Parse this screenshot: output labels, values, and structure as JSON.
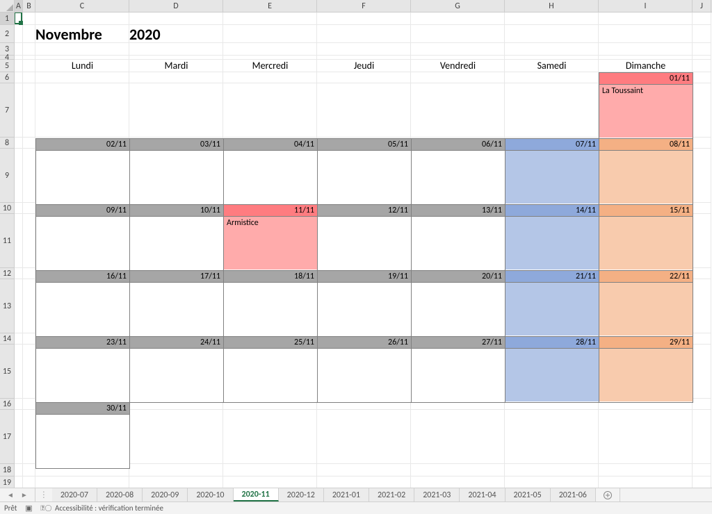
{
  "columns": [
    {
      "label": "A",
      "w": 12,
      "sel": true
    },
    {
      "label": "B",
      "w": 18
    },
    {
      "label": "C",
      "w": 135
    },
    {
      "label": "D",
      "w": 135
    },
    {
      "label": "E",
      "w": 135
    },
    {
      "label": "F",
      "w": 135
    },
    {
      "label": "G",
      "w": 135
    },
    {
      "label": "H",
      "w": 135
    },
    {
      "label": "I",
      "w": 135
    },
    {
      "label": "J",
      "w": 27
    }
  ],
  "rows": [
    {
      "n": 1,
      "h": 18,
      "sel": true
    },
    {
      "n": 2,
      "h": 26
    },
    {
      "n": 3,
      "h": 18
    },
    {
      "n": 4,
      "h": 6
    },
    {
      "n": 5,
      "h": 18
    },
    {
      "n": 6,
      "h": 16
    },
    {
      "n": 7,
      "h": 78
    },
    {
      "n": 8,
      "h": 16
    },
    {
      "n": 9,
      "h": 78
    },
    {
      "n": 10,
      "h": 16
    },
    {
      "n": 11,
      "h": 78
    },
    {
      "n": 12,
      "h": 16
    },
    {
      "n": 13,
      "h": 78
    },
    {
      "n": 14,
      "h": 16
    },
    {
      "n": 15,
      "h": 78
    },
    {
      "n": 16,
      "h": 16
    },
    {
      "n": 17,
      "h": 78
    },
    {
      "n": 18,
      "h": 18
    },
    {
      "n": 19,
      "h": 18
    }
  ],
  "title": {
    "month": "Novembre",
    "year": "2020"
  },
  "day_names": [
    "Lundi",
    "Mardi",
    "Mercredi",
    "Jeudi",
    "Vendredi",
    "Samedi",
    "Dimanche"
  ],
  "weeks": [
    [
      null,
      null,
      null,
      null,
      null,
      null,
      {
        "d": "01/11",
        "txt": "La Toussaint",
        "hol": true,
        "sun": true
      }
    ],
    [
      {
        "d": "02/11"
      },
      {
        "d": "03/11"
      },
      {
        "d": "04/11"
      },
      {
        "d": "05/11"
      },
      {
        "d": "06/11"
      },
      {
        "d": "07/11",
        "sat": true
      },
      {
        "d": "08/11",
        "sun": true
      }
    ],
    [
      {
        "d": "09/11"
      },
      {
        "d": "10/11"
      },
      {
        "d": "11/11",
        "txt": "Armistice",
        "hol": true
      },
      {
        "d": "12/11"
      },
      {
        "d": "13/11"
      },
      {
        "d": "14/11",
        "sat": true
      },
      {
        "d": "15/11",
        "sun": true
      }
    ],
    [
      {
        "d": "16/11"
      },
      {
        "d": "17/11"
      },
      {
        "d": "18/11"
      },
      {
        "d": "19/11"
      },
      {
        "d": "20/11"
      },
      {
        "d": "21/11",
        "sat": true
      },
      {
        "d": "22/11",
        "sun": true
      }
    ],
    [
      {
        "d": "23/11"
      },
      {
        "d": "24/11"
      },
      {
        "d": "25/11"
      },
      {
        "d": "26/11"
      },
      {
        "d": "27/11"
      },
      {
        "d": "28/11",
        "sat": true
      },
      {
        "d": "29/11",
        "sun": true
      }
    ],
    [
      {
        "d": "30/11"
      },
      null,
      null,
      null,
      null,
      null,
      null
    ]
  ],
  "tabs": [
    "2020-07",
    "2020-08",
    "2020-09",
    "2020-10",
    "2020-11",
    "2020-12",
    "2021-01",
    "2021-02",
    "2021-03",
    "2021-04",
    "2021-05",
    "2021-06"
  ],
  "active_tab": "2020-11",
  "status": {
    "ready": "Prêt",
    "access": "Accessibilité : vérification terminée"
  }
}
